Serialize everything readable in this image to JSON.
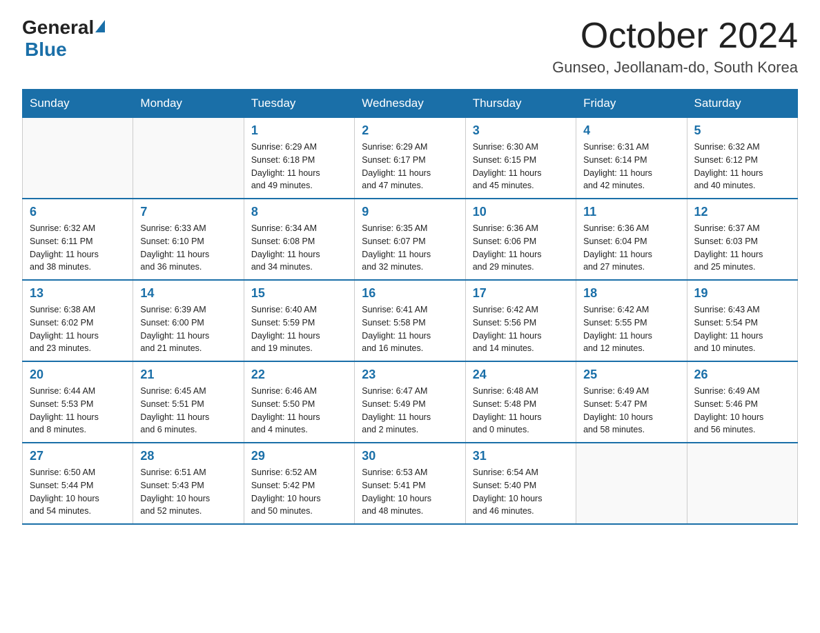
{
  "logo": {
    "general": "General",
    "blue": "Blue"
  },
  "title": "October 2024",
  "location": "Gunseo, Jeollanam-do, South Korea",
  "days_of_week": [
    "Sunday",
    "Monday",
    "Tuesday",
    "Wednesday",
    "Thursday",
    "Friday",
    "Saturday"
  ],
  "weeks": [
    [
      {
        "day": "",
        "info": ""
      },
      {
        "day": "",
        "info": ""
      },
      {
        "day": "1",
        "info": "Sunrise: 6:29 AM\nSunset: 6:18 PM\nDaylight: 11 hours\nand 49 minutes."
      },
      {
        "day": "2",
        "info": "Sunrise: 6:29 AM\nSunset: 6:17 PM\nDaylight: 11 hours\nand 47 minutes."
      },
      {
        "day": "3",
        "info": "Sunrise: 6:30 AM\nSunset: 6:15 PM\nDaylight: 11 hours\nand 45 minutes."
      },
      {
        "day": "4",
        "info": "Sunrise: 6:31 AM\nSunset: 6:14 PM\nDaylight: 11 hours\nand 42 minutes."
      },
      {
        "day": "5",
        "info": "Sunrise: 6:32 AM\nSunset: 6:12 PM\nDaylight: 11 hours\nand 40 minutes."
      }
    ],
    [
      {
        "day": "6",
        "info": "Sunrise: 6:32 AM\nSunset: 6:11 PM\nDaylight: 11 hours\nand 38 minutes."
      },
      {
        "day": "7",
        "info": "Sunrise: 6:33 AM\nSunset: 6:10 PM\nDaylight: 11 hours\nand 36 minutes."
      },
      {
        "day": "8",
        "info": "Sunrise: 6:34 AM\nSunset: 6:08 PM\nDaylight: 11 hours\nand 34 minutes."
      },
      {
        "day": "9",
        "info": "Sunrise: 6:35 AM\nSunset: 6:07 PM\nDaylight: 11 hours\nand 32 minutes."
      },
      {
        "day": "10",
        "info": "Sunrise: 6:36 AM\nSunset: 6:06 PM\nDaylight: 11 hours\nand 29 minutes."
      },
      {
        "day": "11",
        "info": "Sunrise: 6:36 AM\nSunset: 6:04 PM\nDaylight: 11 hours\nand 27 minutes."
      },
      {
        "day": "12",
        "info": "Sunrise: 6:37 AM\nSunset: 6:03 PM\nDaylight: 11 hours\nand 25 minutes."
      }
    ],
    [
      {
        "day": "13",
        "info": "Sunrise: 6:38 AM\nSunset: 6:02 PM\nDaylight: 11 hours\nand 23 minutes."
      },
      {
        "day": "14",
        "info": "Sunrise: 6:39 AM\nSunset: 6:00 PM\nDaylight: 11 hours\nand 21 minutes."
      },
      {
        "day": "15",
        "info": "Sunrise: 6:40 AM\nSunset: 5:59 PM\nDaylight: 11 hours\nand 19 minutes."
      },
      {
        "day": "16",
        "info": "Sunrise: 6:41 AM\nSunset: 5:58 PM\nDaylight: 11 hours\nand 16 minutes."
      },
      {
        "day": "17",
        "info": "Sunrise: 6:42 AM\nSunset: 5:56 PM\nDaylight: 11 hours\nand 14 minutes."
      },
      {
        "day": "18",
        "info": "Sunrise: 6:42 AM\nSunset: 5:55 PM\nDaylight: 11 hours\nand 12 minutes."
      },
      {
        "day": "19",
        "info": "Sunrise: 6:43 AM\nSunset: 5:54 PM\nDaylight: 11 hours\nand 10 minutes."
      }
    ],
    [
      {
        "day": "20",
        "info": "Sunrise: 6:44 AM\nSunset: 5:53 PM\nDaylight: 11 hours\nand 8 minutes."
      },
      {
        "day": "21",
        "info": "Sunrise: 6:45 AM\nSunset: 5:51 PM\nDaylight: 11 hours\nand 6 minutes."
      },
      {
        "day": "22",
        "info": "Sunrise: 6:46 AM\nSunset: 5:50 PM\nDaylight: 11 hours\nand 4 minutes."
      },
      {
        "day": "23",
        "info": "Sunrise: 6:47 AM\nSunset: 5:49 PM\nDaylight: 11 hours\nand 2 minutes."
      },
      {
        "day": "24",
        "info": "Sunrise: 6:48 AM\nSunset: 5:48 PM\nDaylight: 11 hours\nand 0 minutes."
      },
      {
        "day": "25",
        "info": "Sunrise: 6:49 AM\nSunset: 5:47 PM\nDaylight: 10 hours\nand 58 minutes."
      },
      {
        "day": "26",
        "info": "Sunrise: 6:49 AM\nSunset: 5:46 PM\nDaylight: 10 hours\nand 56 minutes."
      }
    ],
    [
      {
        "day": "27",
        "info": "Sunrise: 6:50 AM\nSunset: 5:44 PM\nDaylight: 10 hours\nand 54 minutes."
      },
      {
        "day": "28",
        "info": "Sunrise: 6:51 AM\nSunset: 5:43 PM\nDaylight: 10 hours\nand 52 minutes."
      },
      {
        "day": "29",
        "info": "Sunrise: 6:52 AM\nSunset: 5:42 PM\nDaylight: 10 hours\nand 50 minutes."
      },
      {
        "day": "30",
        "info": "Sunrise: 6:53 AM\nSunset: 5:41 PM\nDaylight: 10 hours\nand 48 minutes."
      },
      {
        "day": "31",
        "info": "Sunrise: 6:54 AM\nSunset: 5:40 PM\nDaylight: 10 hours\nand 46 minutes."
      },
      {
        "day": "",
        "info": ""
      },
      {
        "day": "",
        "info": ""
      }
    ]
  ]
}
